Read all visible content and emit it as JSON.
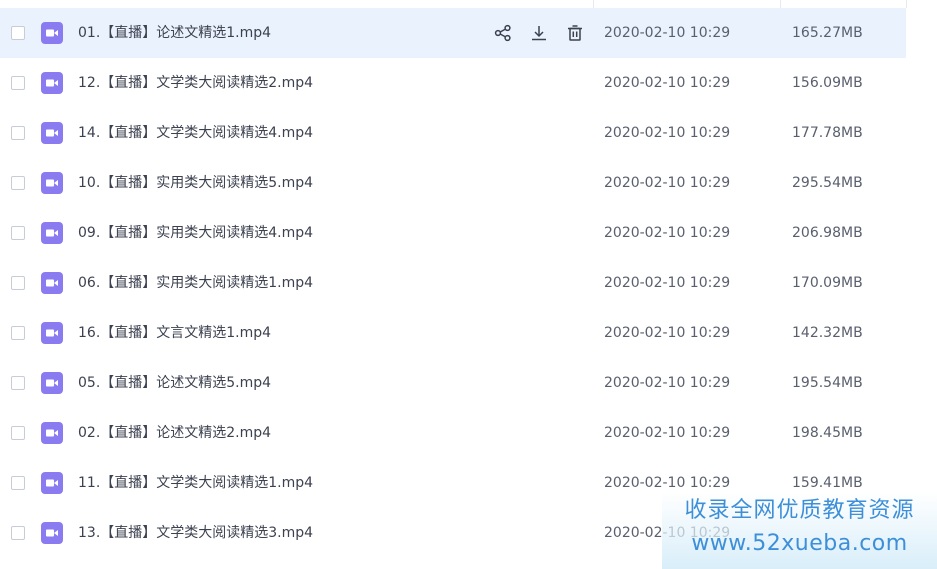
{
  "colors": {
    "selected_row_bg": "#eaf3fd",
    "video_icon": "#8a7cf0",
    "text_primary": "#3c4150",
    "text_secondary": "#595f6e",
    "watermark_text": "#3d8fd8"
  },
  "row_actions": {
    "share_icon": "share-icon",
    "download_icon": "download-icon",
    "delete_icon": "trash-icon"
  },
  "files": [
    {
      "name": "01.【直播】论述文精选1.mp4",
      "date": "2020-02-10 10:29",
      "size": "165.27MB",
      "selected": true
    },
    {
      "name": "12.【直播】文学类大阅读精选2.mp4",
      "date": "2020-02-10 10:29",
      "size": "156.09MB"
    },
    {
      "name": "14.【直播】文学类大阅读精选4.mp4",
      "date": "2020-02-10 10:29",
      "size": "177.78MB"
    },
    {
      "name": "10.【直播】实用类大阅读精选5.mp4",
      "date": "2020-02-10 10:29",
      "size": "295.54MB"
    },
    {
      "name": "09.【直播】实用类大阅读精选4.mp4",
      "date": "2020-02-10 10:29",
      "size": "206.98MB"
    },
    {
      "name": "06.【直播】实用类大阅读精选1.mp4",
      "date": "2020-02-10 10:29",
      "size": "170.09MB"
    },
    {
      "name": "16.【直播】文言文精选1.mp4",
      "date": "2020-02-10 10:29",
      "size": "142.32MB"
    },
    {
      "name": "05.【直播】论述文精选5.mp4",
      "date": "2020-02-10 10:29",
      "size": "195.54MB"
    },
    {
      "name": "02.【直播】论述文精选2.mp4",
      "date": "2020-02-10 10:29",
      "size": "198.45MB"
    },
    {
      "name": "11.【直播】文学类大阅读精选1.mp4",
      "date": "2020-02-10 10:29",
      "size": "159.41MB"
    },
    {
      "name": "13.【直播】文学类大阅读精选3.mp4",
      "date": "2020-02-10 10:29",
      "size": ""
    }
  ],
  "watermark": {
    "line1": "收录全网优质教育资源",
    "line2": "www.52xueba.com"
  }
}
